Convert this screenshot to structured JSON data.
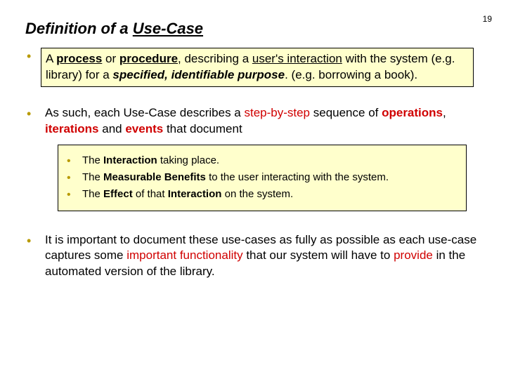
{
  "page_number": "19",
  "title_prefix": "Definition of a ",
  "title_term": "Use-Case",
  "b1": {
    "t1": "A ",
    "t2": "process",
    "t3": " or ",
    "t4": "procedure",
    "t5": ", describing a ",
    "t6": "user's interaction",
    "t7": " with the system (e.g. library) for a ",
    "t8": "specified, identifiable purpose",
    "t9": ". (e.g. borrowing a book)."
  },
  "b2": {
    "t1": "As such, each Use-Case describes a ",
    "t2": "step-by-step",
    "t3": " sequence of ",
    "t4": "operations",
    "t5": ", ",
    "t6": "iterations",
    "t7": " and ",
    "t8": "events",
    "t9": " that document"
  },
  "sub": {
    "s1a": "The ",
    "s1b": "Interaction",
    "s1c": " taking place.",
    "s2a": "The ",
    "s2b": "Measurable Benefits",
    "s2c": " to the user interacting with the system.",
    "s3a": "The ",
    "s3b": "Effect",
    "s3c": " of that ",
    "s3d": "Interaction",
    "s3e": " on the system."
  },
  "b3": {
    "t1": "It is important to document these use-cases as fully as possible as each use-case captures some ",
    "t2": "important functionality",
    "t3": " that our system will have to ",
    "t4": "provide",
    "t5": " in the automated version of the library."
  }
}
